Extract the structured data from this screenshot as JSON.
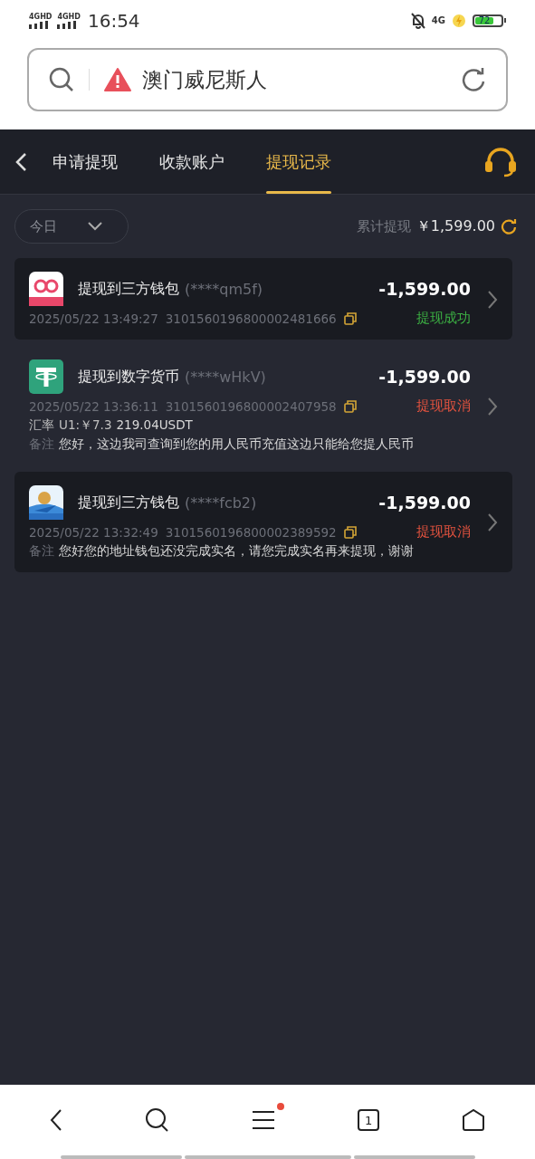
{
  "status_bar": {
    "sim_labels": [
      "4GHD",
      "4GHD"
    ],
    "time": "16:54",
    "network": "4G",
    "battery": "72"
  },
  "address_bar": {
    "title": "澳门威尼斯人"
  },
  "tabs": [
    {
      "label": "申请提现",
      "selected": false
    },
    {
      "label": "收款账户",
      "selected": false
    },
    {
      "label": "提现记录",
      "selected": true
    }
  ],
  "filter": {
    "value": "今日"
  },
  "total": {
    "label": "累计提现",
    "amount": "￥1,599.00"
  },
  "records": [
    {
      "kind": "pay58",
      "shaded": true,
      "title": "提现到三方钱包",
      "account": "(****qm5f)",
      "amount": "-1,599.00",
      "time": "2025/05/22 13:49:27",
      "order_no": "3101560196800002481666",
      "status": "提现成功",
      "color": "#3cb043"
    },
    {
      "kind": "tether",
      "shaded": false,
      "title": "提现到数字货币",
      "account": "(****wHkV)",
      "amount": "-1,599.00",
      "time": "2025/05/22 13:36:11",
      "order_no": "3101560196800002407958",
      "status": "提现取消",
      "color": "#e5533f",
      "rate_label": "汇率",
      "rate": "U1:￥7.3",
      "crypto_amount": "219.04USDT",
      "note_label": "备注",
      "note": "您好，这边我司查询到您的用人民币充值这边只能给您提人民币"
    },
    {
      "kind": "app",
      "shaded": true,
      "title": "提现到三方钱包",
      "account": "(****fcb2)",
      "amount": "-1,599.00",
      "time": "2025/05/22 13:32:49",
      "order_no": "3101560196800002389592",
      "status": "提现取消",
      "color": "#e5533f",
      "note_label": "备注",
      "note": "您好您的地址钱包还没完成实名，请您完成实名再来提现，谢谢"
    }
  ],
  "browser_toolbar": {
    "menu_notification": true,
    "tab_count": "1"
  }
}
